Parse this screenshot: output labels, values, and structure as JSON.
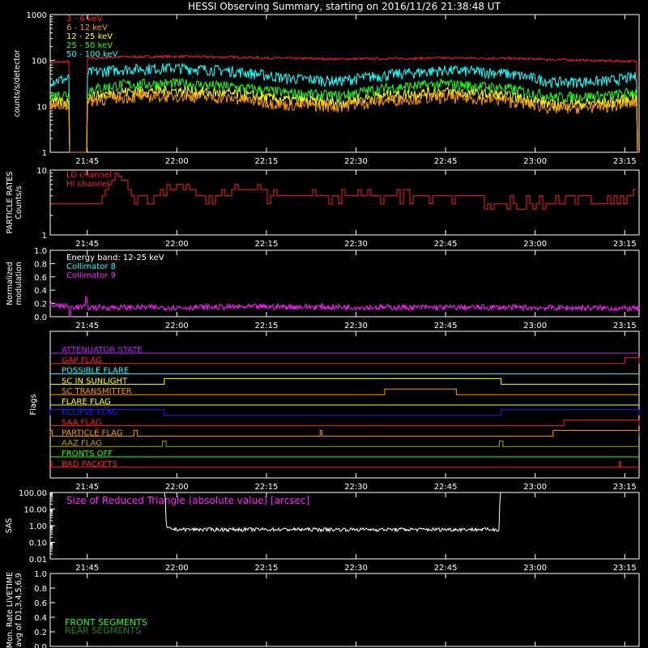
{
  "title": "HESSI Observing Summary, starting on 2016/11/26 21:38:48 UT",
  "time_ticks": [
    "21:45",
    "22:00",
    "22:15",
    "22:30",
    "22:45",
    "23:00",
    "23:15"
  ],
  "chart_data": [
    {
      "id": "counts",
      "type": "line",
      "ylabel": "counts/s/detector",
      "ylog": true,
      "ylim": [
        1,
        1000
      ],
      "yticks": [
        "1",
        "10",
        "100",
        "1000"
      ],
      "xlim_hours": [
        21.6467,
        23.29
      ],
      "gaps": [
        [
          21.7,
          21.75
        ],
        [
          23.285,
          23.29
        ]
      ],
      "series": [
        {
          "name": "3 - 6 keV",
          "color": "#ff2020",
          "x": [
            21.647,
            21.7,
            21.75,
            21.85,
            22.0,
            22.15,
            22.3,
            22.45,
            22.6,
            22.75,
            22.9,
            23.05,
            23.2,
            23.285
          ],
          "y": [
            90,
            95,
            110,
            120,
            122,
            118,
            112,
            108,
            110,
            113,
            112,
            105,
            98,
            95
          ]
        },
        {
          "name": "6 - 12 keV",
          "color": "#ff9a00",
          "x": [
            21.647,
            21.7,
            21.75,
            21.85,
            22.0,
            22.15,
            22.3,
            22.45,
            22.6,
            22.75,
            22.9,
            23.05,
            23.2,
            23.285
          ],
          "y": [
            10,
            11,
            13,
            16,
            17,
            15,
            11,
            10,
            14,
            16,
            14,
            9,
            10,
            12
          ]
        },
        {
          "name": "12 - 25 keV",
          "color": "#ffff20",
          "x": [
            21.647,
            21.7,
            21.75,
            21.85,
            22.0,
            22.15,
            22.3,
            22.45,
            22.6,
            22.75,
            22.9,
            23.05,
            23.2,
            23.285
          ],
          "y": [
            12,
            13,
            16,
            21,
            22,
            19,
            14,
            12,
            18,
            21,
            18,
            11,
            12,
            15
          ]
        },
        {
          "name": "25 - 50 keV",
          "color": "#20ff20",
          "x": [
            21.647,
            21.7,
            21.75,
            21.85,
            22.0,
            22.15,
            22.3,
            22.45,
            22.6,
            22.75,
            22.9,
            23.05,
            23.2,
            23.285
          ],
          "y": [
            17,
            19,
            23,
            30,
            32,
            27,
            20,
            17,
            26,
            31,
            26,
            16,
            17,
            21
          ]
        },
        {
          "name": "50 - 100 keV",
          "color": "#20ffff",
          "x": [
            21.647,
            21.7,
            21.75,
            21.85,
            22.0,
            22.15,
            22.3,
            22.45,
            22.6,
            22.75,
            22.9,
            23.05,
            23.2,
            23.285
          ],
          "y": [
            36,
            40,
            55,
            65,
            70,
            60,
            42,
            36,
            50,
            62,
            55,
            34,
            36,
            45
          ]
        }
      ]
    },
    {
      "id": "particle",
      "type": "line",
      "ylabel": [
        "PARTICLE RATES",
        "Counts/s"
      ],
      "ylog": true,
      "ylim": [
        1,
        10
      ],
      "yticks": [
        "1",
        "10"
      ],
      "series": [
        {
          "name": "LO channel",
          "color": "#ff2020",
          "x": [
            21.647,
            21.73,
            21.78,
            21.8,
            21.83,
            21.86,
            21.88,
            21.9,
            22.0,
            22.1,
            22.2,
            22.3,
            22.4,
            22.5,
            22.6,
            22.7,
            22.8,
            22.9,
            23.0,
            23.1,
            23.2,
            23.25,
            23.29
          ],
          "y": [
            3,
            3,
            3,
            4.5,
            9,
            6,
            3,
            4,
            5,
            4,
            5,
            4,
            4,
            4,
            4,
            4,
            4,
            3,
            3,
            4,
            3,
            4,
            5
          ]
        },
        {
          "name": "HI channel",
          "color": "#ff2020",
          "x": [],
          "y": []
        }
      ]
    },
    {
      "id": "modulation",
      "type": "line",
      "ylabel": [
        "Normalized",
        "modulation"
      ],
      "ylim": [
        0,
        1
      ],
      "yticks": [
        "0.0",
        "0.2",
        "0.4",
        "0.6",
        "0.8",
        "1.0"
      ],
      "note": "Energy band: 12-25 keV",
      "series": [
        {
          "name": "Collimator 8",
          "color": "#20ffff",
          "x": [],
          "y": []
        },
        {
          "name": "Collimator 9",
          "color": "#ff20ff",
          "x": [
            21.647,
            21.7,
            21.75,
            22.0,
            22.3,
            22.6,
            22.9,
            23.2,
            23.285
          ],
          "y": [
            0.18,
            0.15,
            0.14,
            0.14,
            0.15,
            0.14,
            0.14,
            0.13,
            0.12
          ]
        }
      ]
    },
    {
      "id": "flags",
      "type": "table",
      "ylabel": "Flags",
      "rows": [
        {
          "name": "ATTENUATOR STATE",
          "color": "#c020ff",
          "segments": []
        },
        {
          "name": "GAP FLAG",
          "color": "#ff2020",
          "segments": [
            [
              23.25,
              23.29
            ]
          ]
        },
        {
          "name": "POSSIBLE FLARE",
          "color": "#20ffff",
          "segments": []
        },
        {
          "name": "SC IN SUNLIGHT",
          "color": "#ffff20",
          "segments": [
            [
              21.965,
              22.905
            ]
          ]
        },
        {
          "name": "SC TRANSMITTER",
          "color": "#ff9a00",
          "segments": [
            [
              22.58,
              22.78
            ]
          ]
        },
        {
          "name": "FLARE FLAG",
          "color": "#ffff20",
          "segments": []
        },
        {
          "name": "ECLIPSE FLAG",
          "color": "#2020ff",
          "segments": [
            [
              21.647,
              21.965
            ],
            [
              22.905,
              23.29
            ]
          ]
        },
        {
          "name": "SAA FLAG",
          "color": "#ff2020",
          "segments": [
            [
              23.08,
              23.29
            ]
          ]
        },
        {
          "name": "PARTICLE FLAG",
          "color": "#ff9a00",
          "segments": [
            [
              21.647,
              21.652
            ],
            [
              21.88,
              21.89
            ],
            [
              22.4,
              22.405
            ],
            [
              23.05,
              23.29
            ]
          ]
        },
        {
          "name": "AAZ FLAG",
          "color": "#b0a000",
          "segments": [
            [
              21.96,
              21.97
            ],
            [
              22.9,
              22.91
            ]
          ]
        },
        {
          "name": "FRONTS OFF",
          "color": "#20ff20",
          "segments": []
        },
        {
          "name": "BAD PACKETS",
          "color": "#ff2020",
          "segments": [
            [
              21.648,
              21.651
            ],
            [
              23.235,
              23.238
            ]
          ]
        }
      ]
    },
    {
      "id": "sas",
      "type": "line",
      "ylabel": "SAS",
      "ylog": true,
      "ylim": [
        0.01,
        100
      ],
      "yticks": [
        "0.01",
        "0.10",
        "1.00",
        "10.00",
        "100.00"
      ],
      "note": "Size of Reduced Triangle (absolute value) [arcsec]",
      "series": [
        {
          "name": "Size of Reduced Triangle",
          "color": "#ffffff",
          "x": [
            21.965,
            21.97,
            22.0,
            22.15,
            22.3,
            22.45,
            22.6,
            22.75,
            22.9,
            22.905
          ],
          "y": [
            100,
            0.7,
            0.6,
            0.6,
            0.6,
            0.6,
            0.6,
            0.6,
            0.6,
            100
          ]
        }
      ]
    },
    {
      "id": "livetime",
      "type": "line",
      "ylabel": [
        "Mon. Rate LIVETIME",
        "avg of D1,3,4,5,6,9"
      ],
      "ylim": [
        0,
        1
      ],
      "yticks": [
        "0.0",
        "0.2",
        "0.4",
        "0.6",
        "0.8",
        "1.0"
      ],
      "series": [
        {
          "name": "FRONT SEGMENTS",
          "color": "#20ff20",
          "x": [],
          "y": []
        },
        {
          "name": "REAR SEGMENTS",
          "color": "#208020",
          "x": [],
          "y": []
        }
      ]
    }
  ]
}
